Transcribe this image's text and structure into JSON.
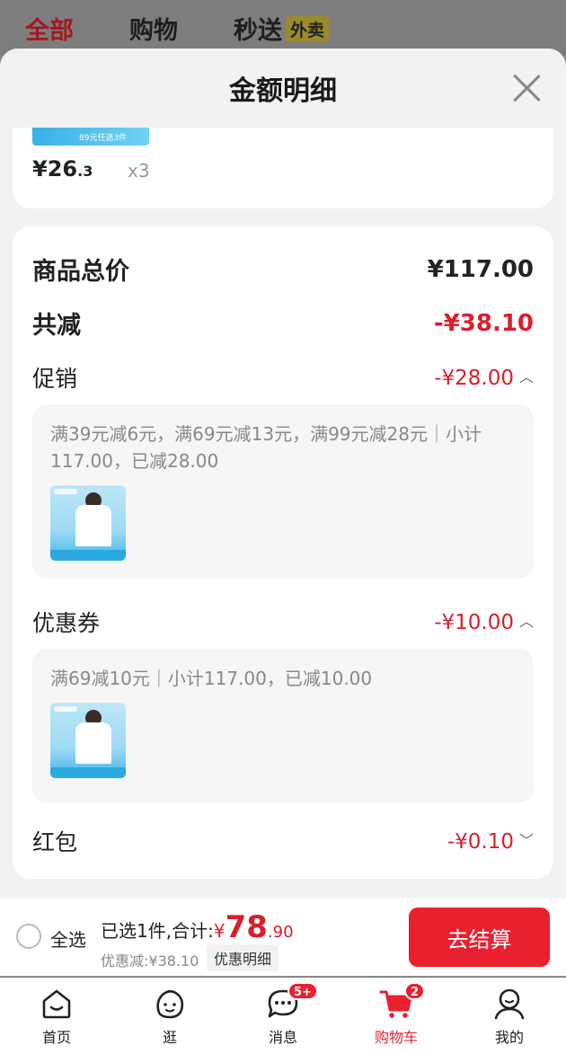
{
  "top_tabs": {
    "all": "全部",
    "shopping": "购物",
    "delivery": "秒送",
    "waimai_badge": "外卖"
  },
  "sheet": {
    "title": "金额明细"
  },
  "item_card": {
    "price_main": "¥26",
    "price_dec": ".3",
    "qty": "x3",
    "strip_text": "89元任选3件"
  },
  "summary": {
    "total_label": "商品总价",
    "total_value": "¥117.00",
    "reduce_label": "共减",
    "reduce_value": "-¥38.10",
    "promo_label": "促销",
    "promo_value": "-¥28.00",
    "promo_desc": "满39元减6元，满69元减13元，满99元减28元｜小计117.00，已减28.00",
    "coupon_label": "优惠券",
    "coupon_value": "-¥10.00",
    "coupon_desc": "满69减10元｜小计117.00，已减10.00",
    "redpack_label": "红包",
    "redpack_value": "-¥0.10"
  },
  "checkout": {
    "select_all": "全选",
    "selected_text": "已选1件,合计:",
    "currency": "¥",
    "amount_int": "78",
    "amount_dec": ".90",
    "discount_text": "优惠减:¥38.10",
    "detail_button": "优惠明细",
    "pay_button": "去结算"
  },
  "nav": {
    "home": "首页",
    "browse": "逛",
    "messages": "消息",
    "messages_badge": "5+",
    "cart": "购物车",
    "cart_badge": "2",
    "mine": "我的"
  },
  "colors": {
    "accent_red": "#e8202f",
    "price_red": "#d8202c"
  }
}
